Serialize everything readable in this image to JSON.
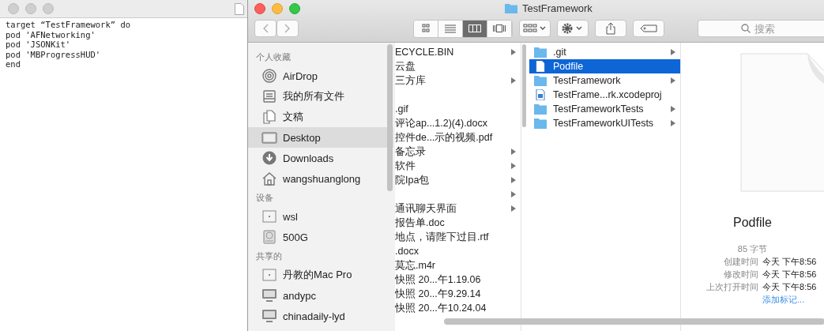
{
  "editor": {
    "lines": [
      "target “TestFramework” do",
      "pod 'AFNetworking'",
      "pod 'JSONKit'",
      "pod 'MBProgressHUD'",
      "end"
    ]
  },
  "finder": {
    "title": "TestFramework",
    "views": [
      {
        "kind": "icons",
        "selected": false
      },
      {
        "kind": "list",
        "selected": false
      },
      {
        "kind": "columns",
        "selected": true
      },
      {
        "kind": "coverflow",
        "selected": false
      }
    ],
    "search": {
      "placeholder": "搜索"
    },
    "sidebar": [
      {
        "heading": "个人收藏",
        "items": [
          {
            "label": "AirDrop",
            "kind": "airdrop",
            "selected": false
          },
          {
            "label": "我的所有文件",
            "kind": "allfiles",
            "selected": false
          },
          {
            "label": "文稿",
            "kind": "documents",
            "selected": false
          },
          {
            "label": "Desktop",
            "kind": "desktop",
            "selected": true
          },
          {
            "label": "Downloads",
            "kind": "downloads",
            "selected": false
          },
          {
            "label": "wangshuanglong",
            "kind": "home",
            "selected": false
          }
        ]
      },
      {
        "heading": "设备",
        "items": [
          {
            "label": "wsl",
            "kind": "disk",
            "selected": false
          },
          {
            "label": "500G",
            "kind": "drive",
            "selected": false
          }
        ]
      },
      {
        "heading": "共享的",
        "items": [
          {
            "label": "丹教的Mac Pro",
            "kind": "disk",
            "selected": false
          },
          {
            "label": "andypc",
            "kind": "monitor",
            "selected": false
          },
          {
            "label": "chinadaily-lyd",
            "kind": "monitor",
            "selected": false
          }
        ]
      }
    ],
    "column_1": [
      {
        "name": "ECYCLE.BIN",
        "has_children": true
      },
      {
        "name": "云盘",
        "has_children": false
      },
      {
        "name": "三方库",
        "has_children": true
      },
      {
        "has_children": false
      },
      {
        "name": ".gif",
        "has_children": false
      },
      {
        "name": "评论ap...1.2)(4).docx",
        "has_children": false
      },
      {
        "name": "控件de...示的视频.pdf",
        "has_children": false
      },
      {
        "name": "备忘录",
        "has_children": true
      },
      {
        "name": "软件",
        "has_children": true
      },
      {
        "name": "院Ipa包",
        "has_children": true
      },
      {
        "has_children": true
      },
      {
        "name": "通讯聊天界面",
        "has_children": true
      },
      {
        "name": "报告单.doc",
        "has_children": false
      },
      {
        "name": "地点，请陛下过目.rtf",
        "has_children": false
      },
      {
        "name": ".docx",
        "has_children": false
      },
      {
        "name": "莫忘.m4r",
        "has_children": false
      },
      {
        "name": "快照 20...午1.19.06",
        "has_children": false
      },
      {
        "name": "快照 20...午9.29.14",
        "has_children": false
      },
      {
        "name": "快照 20...午10.24.04",
        "has_children": false
      }
    ],
    "column_2": [
      {
        "name": ".git",
        "kind": "folder",
        "has_children": true,
        "selected": false
      },
      {
        "name": "Podfile",
        "kind": "file",
        "has_children": false,
        "selected": true
      },
      {
        "name": "TestFramework",
        "kind": "folder",
        "has_children": true,
        "selected": false
      },
      {
        "name": "TestFrame...rk.xcodeproj",
        "kind": "project",
        "has_children": false,
        "selected": false
      },
      {
        "name": "TestFrameworkTests",
        "kind": "folder",
        "has_children": true,
        "selected": false
      },
      {
        "name": "TestFrameworkUITests",
        "kind": "folder",
        "has_children": true,
        "selected": false
      }
    ],
    "preview": {
      "name": "Podfile",
      "size": "85 字节",
      "info": [
        {
          "label": "创建时间",
          "value": "今天 下午8:56"
        },
        {
          "label": "修改时间",
          "value": "今天 下午8:56"
        },
        {
          "label": "上次打开时间",
          "value": "今天 下午8:56"
        }
      ],
      "link": "添加标记..."
    }
  }
}
